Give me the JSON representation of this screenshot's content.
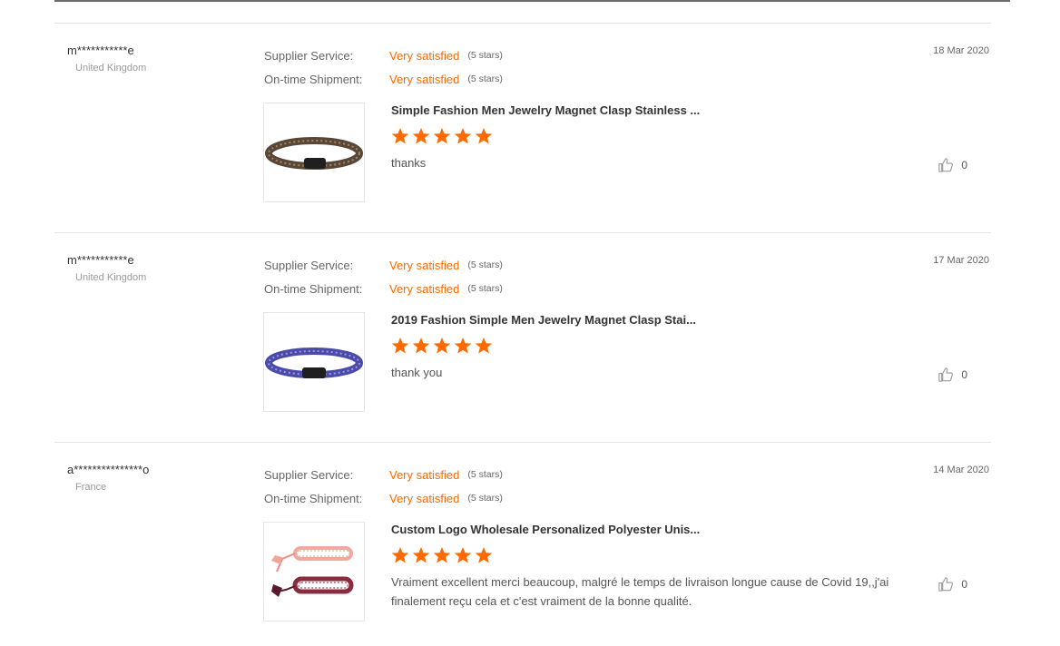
{
  "colors": {
    "accent": "#ff6a00",
    "divider": "#e6e6e6",
    "muted": "#9a9a9a"
  },
  "reviews": [
    {
      "buyer_name": "m***********e",
      "buyer_country": "United Kingdom",
      "supplier_service_label": "Supplier Service:",
      "supplier_service_value": "Very satisfied",
      "supplier_service_stars": "(5 stars)",
      "shipment_label": "On-time Shipment:",
      "shipment_value": "Very satisfied",
      "shipment_stars": "(5 stars)",
      "date": "18 Mar 2020",
      "product_title": "Simple Fashion Men Jewelry Magnet Clasp Stainless ...",
      "product_rating": 5,
      "review_text": "thanks",
      "product_image": "brown-braided-bracelet",
      "like_icon": "thumbs-up-icon",
      "likes": "0"
    },
    {
      "buyer_name": "m***********e",
      "buyer_country": "United Kingdom",
      "supplier_service_label": "Supplier Service:",
      "supplier_service_value": "Very satisfied",
      "supplier_service_stars": "(5 stars)",
      "shipment_label": "On-time Shipment:",
      "shipment_value": "Very satisfied",
      "shipment_stars": "(5 stars)",
      "date": "17 Mar 2020",
      "product_title": "2019 Fashion Simple Men Jewelry Magnet Clasp Stai...",
      "product_rating": 5,
      "review_text": "thank you",
      "product_image": "blue-braided-bracelet",
      "like_icon": "thumbs-up-icon",
      "likes": "0"
    },
    {
      "buyer_name": "a***************o",
      "buyer_country": "France",
      "supplier_service_label": "Supplier Service:",
      "supplier_service_value": "Very satisfied",
      "supplier_service_stars": "(5 stars)",
      "shipment_label": "On-time Shipment:",
      "shipment_value": "Very satisfied",
      "shipment_stars": "(5 stars)",
      "date": "14 Mar 2020",
      "product_title": "Custom Logo Wholesale Personalized Polyester Unis...",
      "product_rating": 5,
      "review_text": "Vraiment excellent merci beaucoup, malgré le temps de livraison longue cause de Covid 19,,j'ai finalement reçu cela et c'est vraiment de la bonne qualité.",
      "product_image": "tassel-bracelets",
      "like_icon": "thumbs-up-icon",
      "likes": "0"
    }
  ]
}
